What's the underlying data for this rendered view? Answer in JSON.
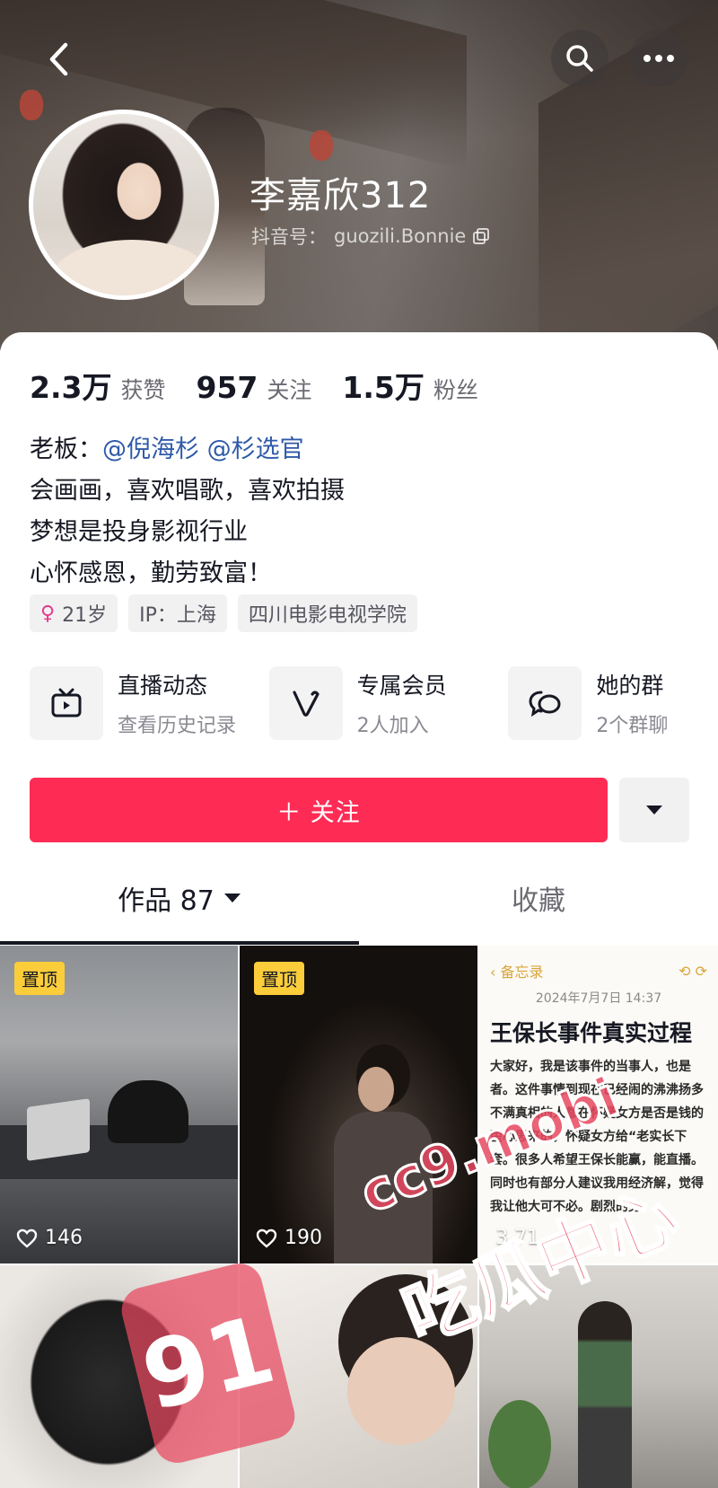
{
  "header": {
    "name": "李嘉欣312",
    "douyin_id_label": "抖音号：",
    "douyin_id": "guozili.Bonnie"
  },
  "stats": [
    {
      "value": "2.3万",
      "label": "获赞"
    },
    {
      "value": "957",
      "label": "关注"
    },
    {
      "value": "1.5万",
      "label": "粉丝"
    }
  ],
  "bio": {
    "boss_prefix": "老板：",
    "mention_1": "@倪海杉",
    "mention_2": "@杉选官",
    "line_2": "会画画，喜欢唱歌，喜欢拍摄",
    "line_3": "梦想是投身影视行业",
    "line_4": "心怀感恩，勤劳致富！"
  },
  "tags": {
    "age": "21岁",
    "ip": "IP：上海",
    "school": "四川电影电视学院"
  },
  "features": [
    {
      "title": "直播动态",
      "sub": "查看历史记录",
      "icon": "tv-icon"
    },
    {
      "title": "专属会员",
      "sub": "2人加入",
      "icon": "v-icon"
    },
    {
      "title": "她的群",
      "sub": "2个群聊",
      "icon": "chat-icon"
    }
  ],
  "follow_button": "＋ 关注",
  "tabs": {
    "works": "作品 87",
    "favorites": "收藏"
  },
  "grid": {
    "pinned_label": "置顶",
    "tile_1_likes": "146",
    "tile_2_likes": "190",
    "tile_3_likes": "3.71",
    "memo": {
      "back": "备忘录",
      "date": "2024年7月7日 14:37",
      "title": "王保长事件真实过程",
      "text": "大家好，我是该事件的当事人，也是者。这件事情到现在已经闹的沸沸扬多不满真相的人都在怀疑女方是否是钱的歪心思来的，怀疑女方给“老实长下套。很多人希望王保长能赢，能直播。同时也有部分人建议我用经济解，觉得我让他大可不必。剧烈的男"
    }
  },
  "watermark": {
    "number": "91",
    "url": "cc9.mobi",
    "title": "吃瓜中心"
  },
  "colors": {
    "accent": "#fe2c55",
    "pin": "#fbcd3b",
    "mention": "#2f5aa8"
  }
}
